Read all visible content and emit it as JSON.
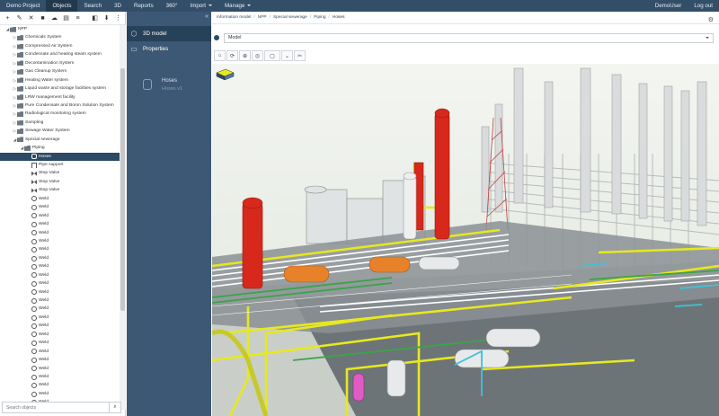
{
  "topnav": {
    "items": [
      {
        "label": "Demo Project"
      },
      {
        "label": "Objects"
      },
      {
        "label": "Search"
      },
      {
        "label": "3D"
      },
      {
        "label": "Reports"
      },
      {
        "label": "360°"
      },
      {
        "label": "Import"
      },
      {
        "label": "Manage"
      }
    ],
    "user": "DemoUser",
    "logout": "Log out"
  },
  "tree": {
    "rows": [
      {
        "label": "NPP"
      },
      {
        "label": "Chemicals System"
      },
      {
        "label": "Compressed Air System"
      },
      {
        "label": "Condensate and heating steam system"
      },
      {
        "label": "Decontamination System"
      },
      {
        "label": "Gas Cleanup System"
      },
      {
        "label": "Heating Water system"
      },
      {
        "label": "Liquid waste and storage facilities system"
      },
      {
        "label": "LRW management facility"
      },
      {
        "label": "Pure Condensate and Boron Solution System"
      },
      {
        "label": "Radiological monitoring system"
      },
      {
        "label": "Sampling"
      },
      {
        "label": "Sewage Water System"
      },
      {
        "label": "Special sewerage"
      },
      {
        "label": "Piping"
      },
      {
        "label": "Hoses"
      },
      {
        "label": "Pipe support"
      },
      {
        "label": "Stop Valve"
      },
      {
        "label": "Stop Valve"
      },
      {
        "label": "Stop Valve"
      },
      {
        "label": "Weld"
      },
      {
        "label": "Weld"
      },
      {
        "label": "Weld"
      },
      {
        "label": "Weld"
      },
      {
        "label": "Weld"
      },
      {
        "label": "Weld"
      },
      {
        "label": "Weld"
      },
      {
        "label": "Weld"
      },
      {
        "label": "Weld"
      },
      {
        "label": "Weld"
      },
      {
        "label": "Weld"
      },
      {
        "label": "Weld"
      },
      {
        "label": "Weld"
      },
      {
        "label": "Weld"
      },
      {
        "label": "Weld"
      },
      {
        "label": "Weld"
      },
      {
        "label": "Weld"
      },
      {
        "label": "Weld"
      },
      {
        "label": "Weld"
      },
      {
        "label": "Weld"
      },
      {
        "label": "Weld"
      },
      {
        "label": "Weld"
      },
      {
        "label": "Weld"
      },
      {
        "label": "Weld"
      },
      {
        "label": "Weld"
      }
    ],
    "search_placeholder": "Search objects"
  },
  "mid": {
    "tabs": [
      {
        "label": "3D model"
      },
      {
        "label": "Properties"
      }
    ],
    "chip_name": "Hoses",
    "chip_sub": "Hoses v1"
  },
  "breadcrumb": [
    "Information model",
    "NPP",
    "Special sewerage",
    "Piping",
    "Hoses"
  ],
  "model_select": "Model",
  "colors": {
    "nav_bg": "#334e68",
    "selected_bg": "#2c4a66",
    "panel_bg": "#3d5874",
    "pipe_yellow": "#e8e81e",
    "vessel_red": "#d8281c",
    "tank_orange": "#e8822a"
  }
}
